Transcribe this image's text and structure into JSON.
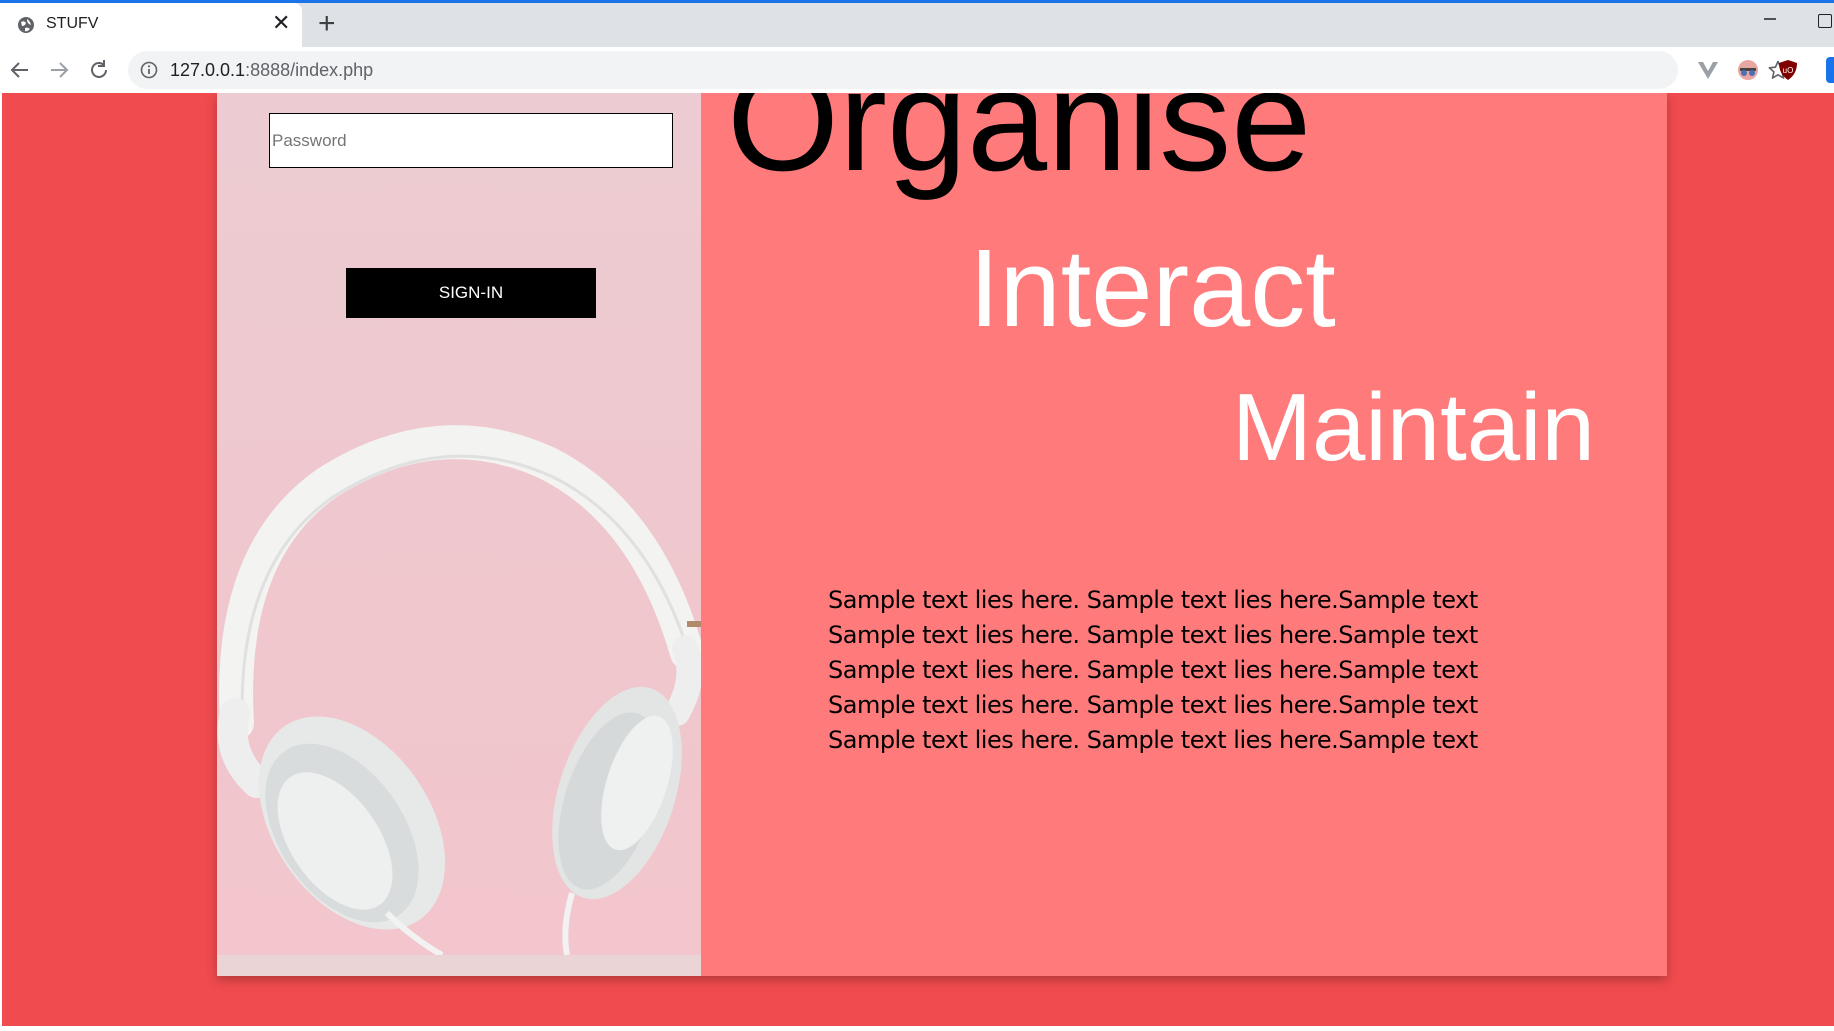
{
  "browser": {
    "tab": {
      "title": "STUFV",
      "close_icon": "close-icon",
      "favicon": "globe-icon"
    },
    "new_tab_label": "+",
    "address_bar": {
      "url_host": "127.0.0.1",
      "url_rest": ":8888/index.php"
    },
    "colors": {
      "accent": "#1a73e8"
    }
  },
  "login": {
    "password_placeholder": "Password",
    "signin_label": "SIGN-IN"
  },
  "hero": {
    "words": [
      "Organise",
      "Interact",
      "Maintain"
    ]
  },
  "sample_text": {
    "lines": [
      "Sample text lies here. Sample text lies here.Sample text",
      "Sample text lies here. Sample text lies here.Sample text",
      "Sample text lies here. Sample text lies here.Sample text",
      "Sample text lies here. Sample text lies here.Sample text",
      "Sample text lies here. Sample text lies here.Sample text"
    ]
  },
  "colors": {
    "page_background": "#f04b4e",
    "card_background": "#ff7b7b",
    "left_panel": "#ebd4d6",
    "button": "#000000"
  }
}
